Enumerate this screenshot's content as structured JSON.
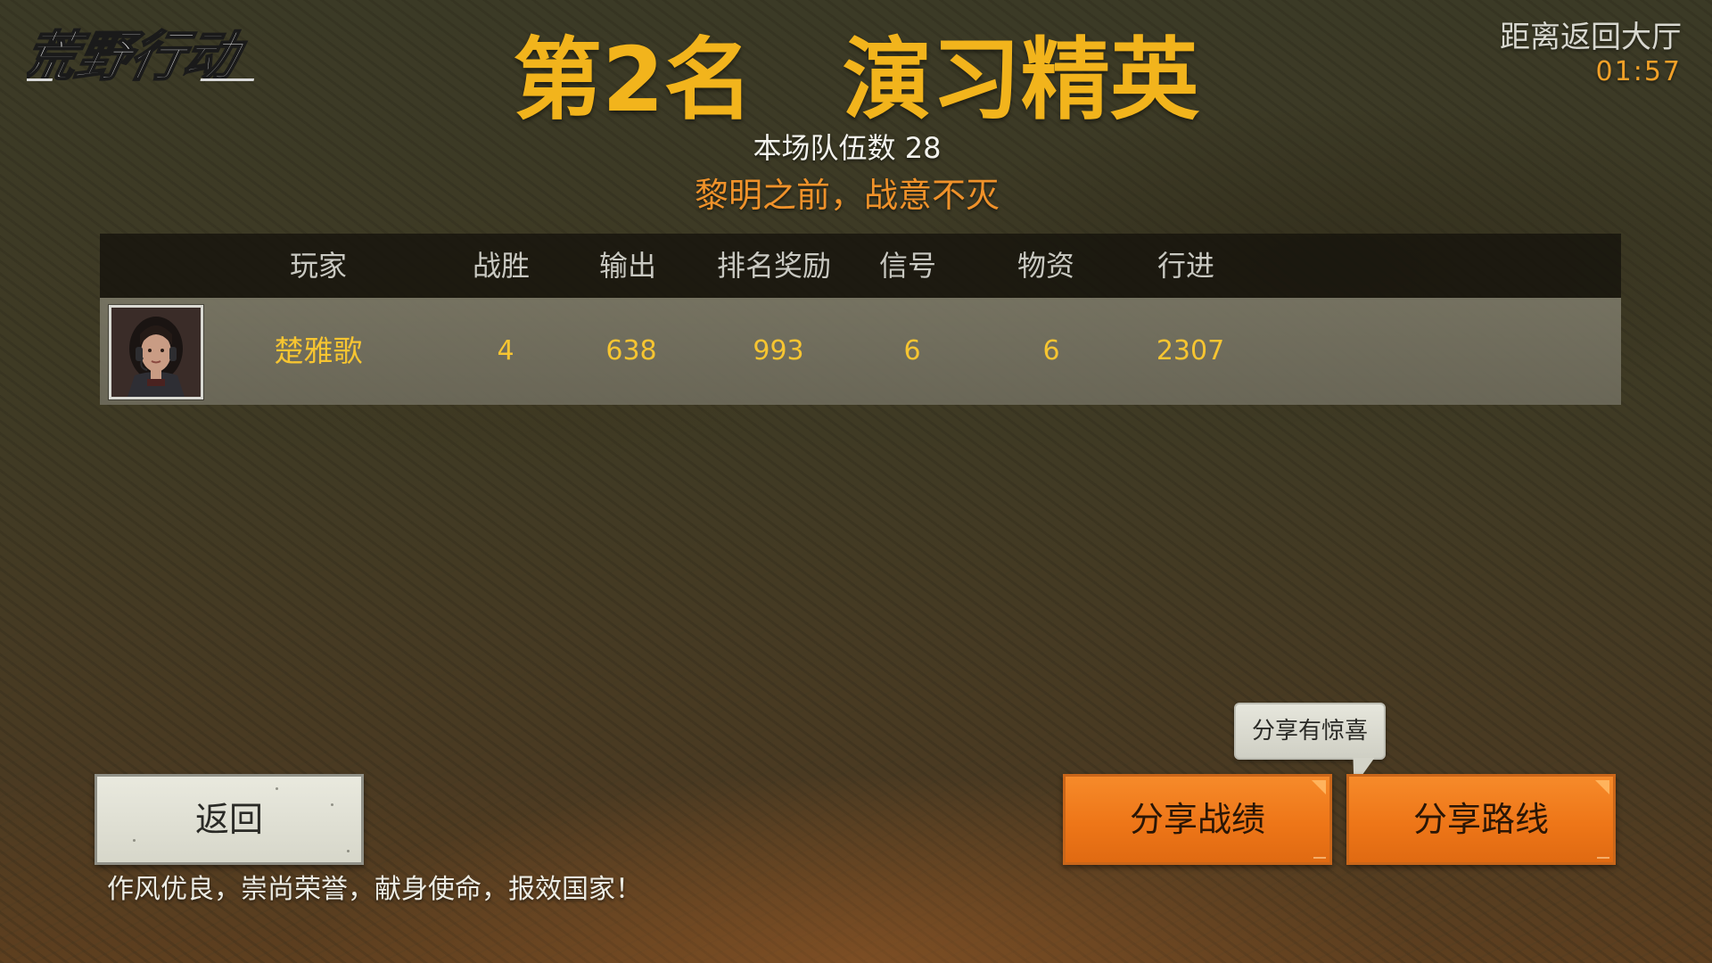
{
  "logo": {
    "text": "荒野行动"
  },
  "header": {
    "rank_title": "第2名　演习精英",
    "team_count_label": "本场队伍数 28",
    "motto": "黎明之前，战意不灭"
  },
  "countdown": {
    "label": "距离返回大厅",
    "time": "01:57"
  },
  "table": {
    "columns": [
      "玩家",
      "战胜",
      "输出",
      "排名奖励",
      "信号",
      "物资",
      "行进"
    ],
    "rows": [
      {
        "avatar": "player-portrait",
        "cells": [
          "楚雅歌",
          "4",
          "638",
          "993",
          "6",
          "6",
          "2307"
        ]
      }
    ]
  },
  "buttons": {
    "back": "返回",
    "share_record": "分享战绩",
    "share_route": "分享路线"
  },
  "tooltip": {
    "text": "分享有惊喜"
  },
  "footer": {
    "motto": "作风优良，崇尚荣誉，献身使命，报效国家！"
  },
  "colors": {
    "title_gold": "#f2b41c",
    "motto_orange": "#f0922a",
    "player_gold": "#f7c531",
    "button_orange": "#ee7618"
  }
}
